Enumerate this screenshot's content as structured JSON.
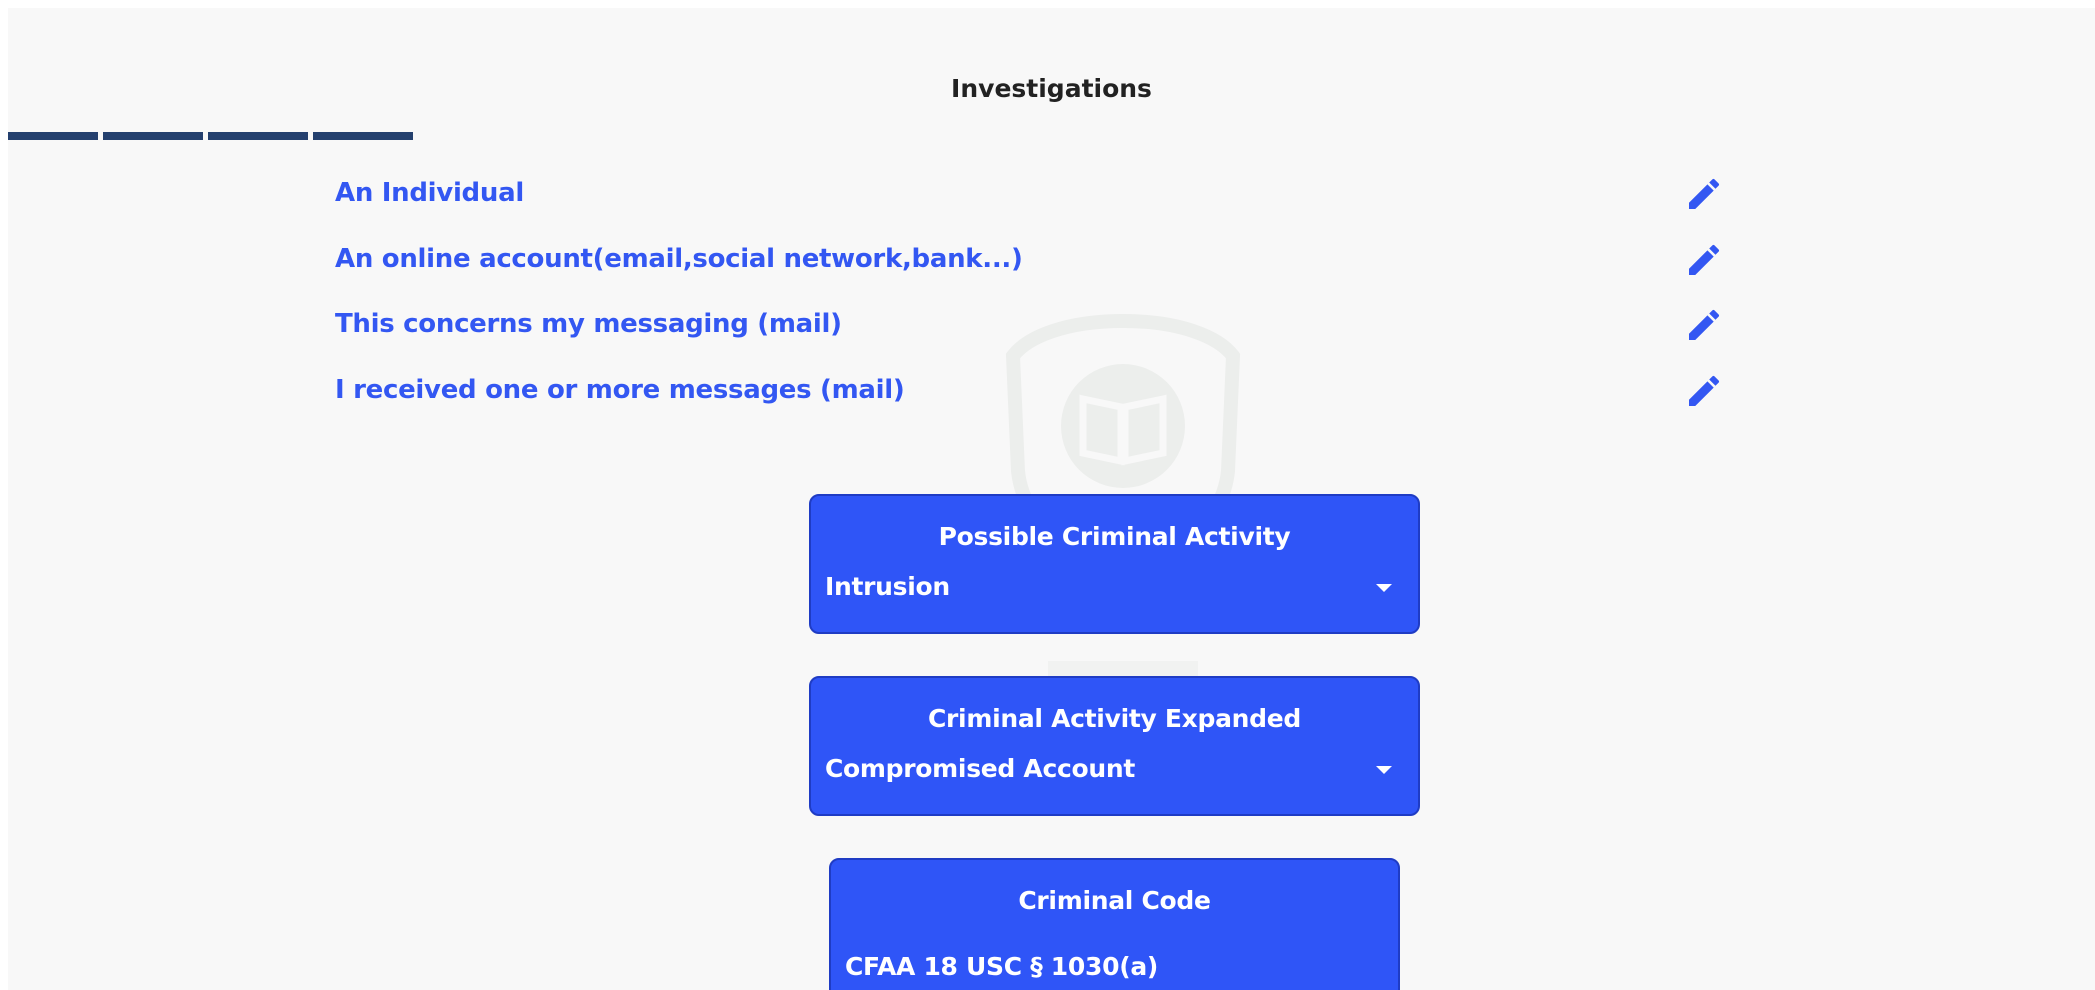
{
  "page": {
    "title": "Investigations"
  },
  "stepper": {
    "step_count": 4,
    "color": "#24406e"
  },
  "investigation_items": [
    {
      "label": "An Individual",
      "action_icon": "pencil-icon"
    },
    {
      "label": "An online account(email,social network,bank...)",
      "action_icon": "pencil-icon"
    },
    {
      "label": "This concerns my messaging (mail)",
      "action_icon": "pencil-icon"
    },
    {
      "label": "I received one or more messages (mail)",
      "action_icon": "pencil-icon"
    }
  ],
  "cards": {
    "criminal_activity": {
      "title": "Possible Criminal Activity",
      "selected": "Intrusion"
    },
    "activity_expanded": {
      "title": "Criminal Activity Expanded",
      "selected": "Compromised Account"
    },
    "criminal_code": {
      "title": "Criminal Code",
      "value": "CFAA 18 USC § 1030(a)"
    }
  },
  "colors": {
    "accent": "#3357f2",
    "card_background": "#2f55f7",
    "page_background": "#f8f8f8",
    "title_text": "#222222"
  }
}
